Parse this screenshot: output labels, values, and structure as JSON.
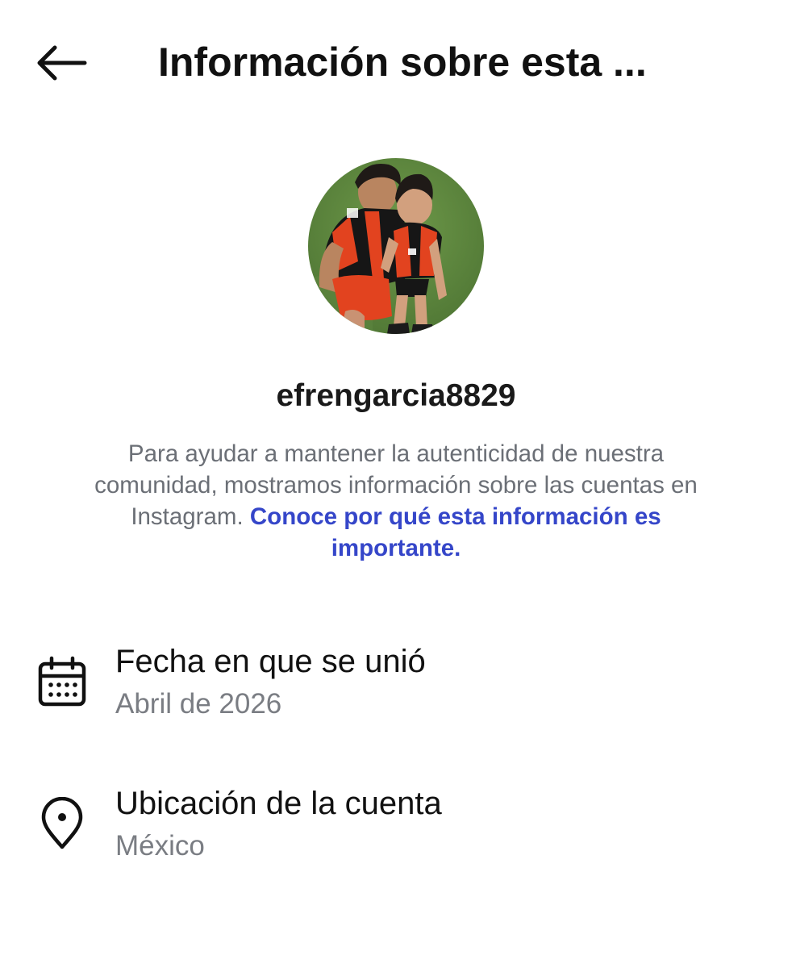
{
  "header": {
    "title": "Información sobre esta ...",
    "back_icon": "arrow-left-icon"
  },
  "profile": {
    "username": "efrengarcia8829",
    "avatar_icon": "profile-photo"
  },
  "description": {
    "text": "Para ayudar a mantener la autenticidad de nuestra comunidad, mostramos información sobre las cuentas en Instagram. ",
    "link_text": "Conoce por qué esta información es importante.",
    "text_color": "#6b6f76",
    "link_color": "#3546c9"
  },
  "info_rows": [
    {
      "icon": "calendar-icon",
      "label": "Fecha en que se unió",
      "value": "Abril de 2026"
    },
    {
      "icon": "location-pin-icon",
      "label": "Ubicación de la cuenta",
      "value": "México"
    }
  ]
}
